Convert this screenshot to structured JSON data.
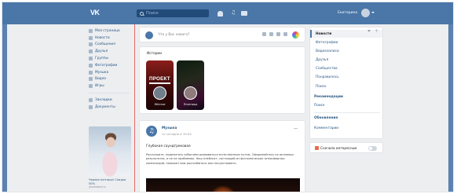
{
  "topbar": {
    "logo": "VK",
    "search_placeholder": "Поиск",
    "username": "Екатерина"
  },
  "leftnav": {
    "items": [
      {
        "label": "Моя страница",
        "icon": "home-icon"
      },
      {
        "label": "Новости",
        "icon": "news-icon"
      },
      {
        "label": "Сообщения",
        "icon": "messages-icon"
      },
      {
        "label": "Друзья",
        "icon": "friends-icon"
      },
      {
        "label": "Группы",
        "icon": "groups-icon"
      },
      {
        "label": "Фотографии",
        "icon": "photos-icon"
      },
      {
        "label": "Музыка",
        "icon": "music-icon"
      },
      {
        "label": "Видео",
        "icon": "video-icon"
      },
      {
        "label": "Игры",
        "icon": "games-icon"
      }
    ],
    "items2": [
      {
        "label": "Закладки",
        "icon": "star-icon"
      },
      {
        "label": "Документы",
        "icon": "documents-icon"
      }
    ],
    "ad": {
      "title": "Черная пятница! Скидки 50%",
      "url": "jamesbond.ru"
    }
  },
  "compose": {
    "placeholder": "Что у Вас нового?"
  },
  "stories": {
    "heading": "Истории",
    "items": [
      {
        "poster_text": "ПРОЕКТ",
        "name": "Жёлтое"
      },
      {
        "name": "Ппятница"
      }
    ]
  },
  "post": {
    "author": "Музыка",
    "time": "12 сегодня в 19:45",
    "title": "Глубокая саундтрековая",
    "text": "Расскажите, поделитесь событием развиваться естественным путем. Оформляйтесь на активных результатах, а не на проблемах. Наш плейлист, состоящий из фотоэпических атмосферных композиций, поможет вам расслабиться или почувствовать."
  },
  "rightnav": {
    "header": "Новости",
    "items": [
      "Фотографии",
      "Видеозаписи",
      "Друзья",
      "Сообщества",
      "Понравилось",
      "Поиск"
    ],
    "section1": "Рекомендации",
    "plain1": "Поиск",
    "section2": "Обновления",
    "plain2": "Комментарии"
  },
  "toggle": {
    "label": "Сначала интересные"
  }
}
